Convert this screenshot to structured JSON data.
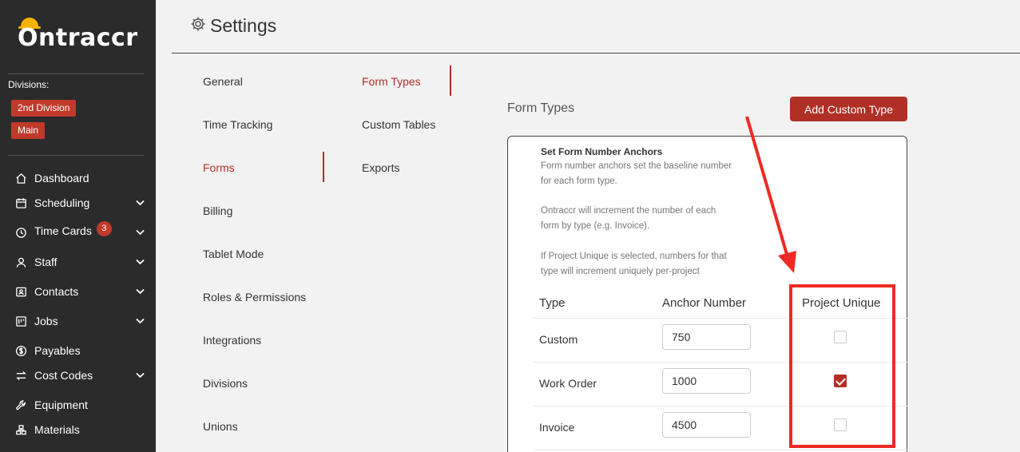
{
  "app": {
    "logo_text": "Ontraccr"
  },
  "sidebar": {
    "divisions_label": "Divisions:",
    "divisions": [
      "2nd Division",
      "Main"
    ],
    "nav": [
      {
        "label": "Dashboard",
        "icon": "home-icon",
        "chevron": false
      },
      {
        "label": "Scheduling",
        "icon": "calendar-icon",
        "chevron": true
      },
      {
        "label": "Time Cards",
        "icon": "clock-icon",
        "chevron": true,
        "badge": "3"
      },
      {
        "label": "Staff",
        "icon": "user-icon",
        "chevron": true
      },
      {
        "label": "Contacts",
        "icon": "contacts-icon",
        "chevron": true
      },
      {
        "label": "Jobs",
        "icon": "jobs-icon",
        "chevron": true
      },
      {
        "label": "Payables",
        "icon": "dollar-icon",
        "chevron": false
      },
      {
        "label": "Cost Codes",
        "icon": "swap-icon",
        "chevron": true
      },
      {
        "label": "Equipment",
        "icon": "wrench-icon",
        "chevron": false
      },
      {
        "label": "Materials",
        "icon": "materials-icon",
        "chevron": false
      }
    ]
  },
  "header": {
    "title": "Settings"
  },
  "settings_menu": [
    "General",
    "Time Tracking",
    "Forms",
    "Billing",
    "Tablet Mode",
    "Roles & Permissions",
    "Integrations",
    "Divisions",
    "Unions"
  ],
  "forms_menu": [
    "Form Types",
    "Custom Tables",
    "Exports"
  ],
  "content": {
    "section_title": "Form Types",
    "add_button": "Add Custom Type",
    "card_title": "Set Form Number Anchors",
    "desc": [
      "Form number anchors set the baseline number",
      "for each form type.",
      "Ontraccr will increment the number of each",
      "form by type (e.g. Invoice).",
      "If Project Unique is selected, numbers for that",
      "type will increment uniquely per-project"
    ],
    "columns": [
      "Type",
      "Anchor Number",
      "Project Unique"
    ],
    "rows": [
      {
        "type": "Custom",
        "anchor": "750",
        "project_unique": false
      },
      {
        "type": "Work Order",
        "anchor": "1000",
        "project_unique": true
      },
      {
        "type": "Invoice",
        "anchor": "4500",
        "project_unique": false
      }
    ]
  },
  "colors": {
    "accent": "#b03026",
    "sidebar_bg": "#2b2b2b",
    "annotation": "#ee2a24"
  }
}
